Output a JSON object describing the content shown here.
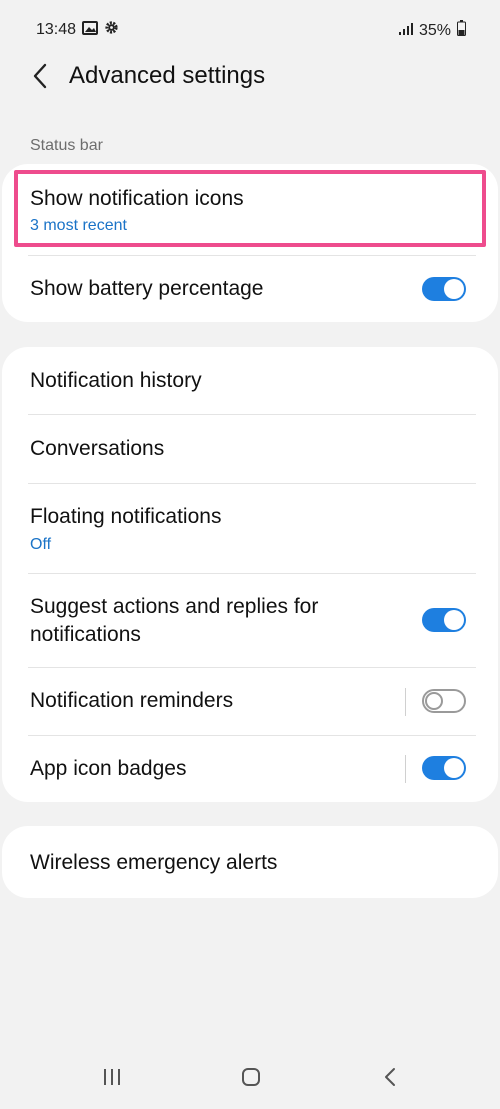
{
  "status_bar": {
    "time": "13:48",
    "left_icons": [
      "image-icon",
      "gear-icon"
    ],
    "right_icons": [
      "signal-icon",
      "battery-icon"
    ],
    "battery_text": "35%"
  },
  "app_bar": {
    "title": "Advanced settings"
  },
  "sections": {
    "status_bar_label": "Status bar"
  },
  "status_bar_card": {
    "show_notification_icons": {
      "label": "Show notification icons",
      "value": "3 most recent"
    },
    "show_battery_percentage": {
      "label": "Show battery percentage",
      "toggle": "on"
    }
  },
  "notifications_card": {
    "notification_history": {
      "label": "Notification history"
    },
    "conversations": {
      "label": "Conversations"
    },
    "floating_notifications": {
      "label": "Floating notifications",
      "value": "Off"
    },
    "suggest_actions": {
      "label_line1": "Suggest actions and replies for",
      "label_line2": "notifications",
      "toggle": "on"
    },
    "notification_reminders": {
      "label": "Notification reminders",
      "toggle": "off"
    },
    "app_icon_badges": {
      "label": "App icon badges",
      "toggle": "on"
    }
  },
  "emergency_card": {
    "wireless_emergency_alerts": {
      "label": "Wireless emergency alerts"
    }
  },
  "nav_bar": {
    "icons": [
      "recents-icon",
      "home-icon",
      "back-icon"
    ]
  },
  "colors": {
    "accent": "#1e7fe0",
    "link": "#1a73c7",
    "highlight": "#ee4c8d",
    "background": "#f2f2f2"
  }
}
